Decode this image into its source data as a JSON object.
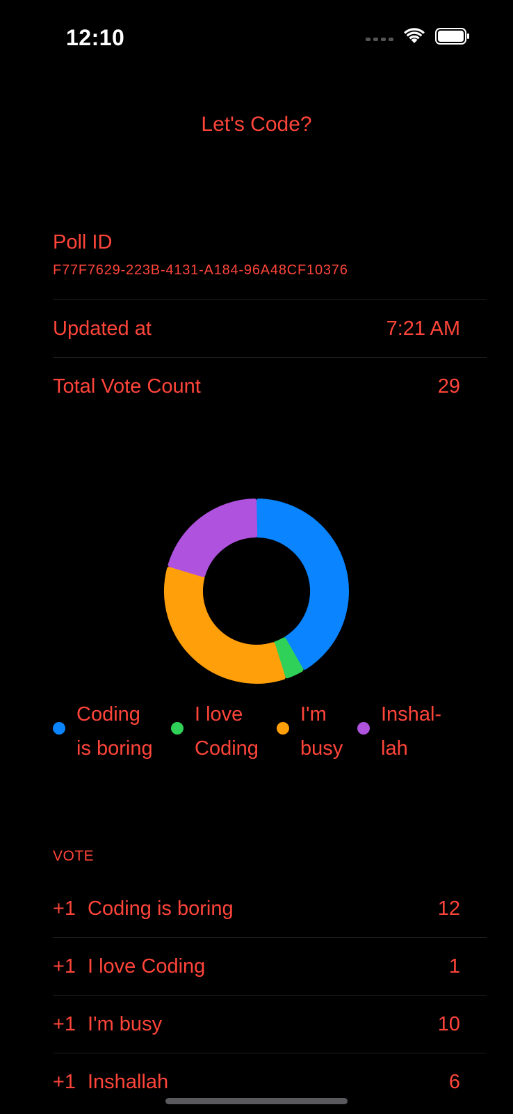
{
  "status_bar": {
    "time": "12:10"
  },
  "nav": {
    "title": "Let's Code?"
  },
  "info": {
    "poll_id_label": "Poll ID",
    "poll_id_value": "F77F7629-223B-4131-A184-96A48CF10376",
    "updated_label": "Updated at",
    "updated_value": "7:21 AM",
    "total_label": "Total Vote Count",
    "total_value": "29"
  },
  "chart_data": {
    "type": "pie",
    "categories": [
      "Coding is boring",
      "I love Coding",
      "I'm busy",
      "Inshallah"
    ],
    "values": [
      12,
      1,
      10,
      6
    ],
    "colors": [
      "#0a84ff",
      "#30d158",
      "#ff9f0a",
      "#af52de"
    ]
  },
  "legend": {
    "items": [
      {
        "line1": "Coding",
        "line2": "is boring",
        "color": "#0a84ff"
      },
      {
        "line1": "I love",
        "line2": "Coding",
        "color": "#30d158"
      },
      {
        "line1": "I'm",
        "line2": "busy",
        "color": "#ff9f0a"
      },
      {
        "line1": "Inshal-",
        "line2": "lah",
        "color": "#af52de"
      }
    ]
  },
  "vote": {
    "header": "VOTE",
    "plus_label": "+1",
    "rows": [
      {
        "label": "Coding is boring",
        "count": "12"
      },
      {
        "label": "I love Coding",
        "count": "1"
      },
      {
        "label": "I'm busy",
        "count": "10"
      },
      {
        "label": "Inshallah",
        "count": "6"
      }
    ]
  }
}
